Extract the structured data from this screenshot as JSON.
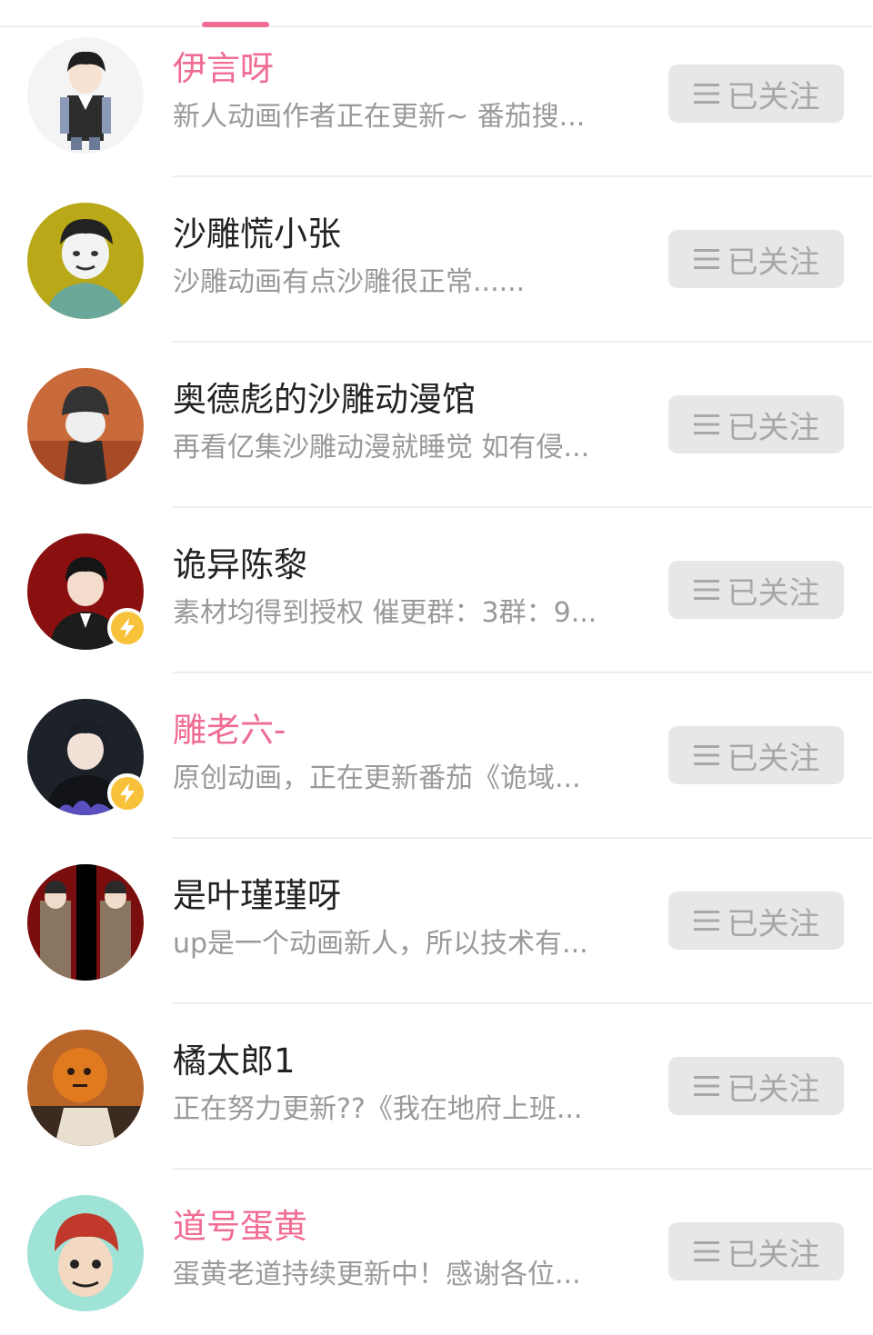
{
  "colors": {
    "accent": "#f06c93",
    "name_default": "#222222",
    "description": "#999999",
    "button_bg": "#e7e7e7",
    "button_text": "#a8a8a8",
    "badge": "#f7c23a"
  },
  "users": [
    {
      "name": "伊言呀",
      "vip": true,
      "badge": false,
      "description": "新人动画作者正在更新~ 番茄搜...",
      "button_label": "已关注",
      "avatar": "character-avatar-boy-vest"
    },
    {
      "name": "沙雕慌小张",
      "vip": false,
      "badge": false,
      "description": "沙雕动画有点沙雕很正常......",
      "button_label": "已关注",
      "avatar": "meme-face-avatar"
    },
    {
      "name": "奥德彪的沙雕动漫馆",
      "vip": false,
      "badge": false,
      "description": "再看亿集沙雕动漫就睡觉 如有侵...",
      "button_label": "已关注",
      "avatar": "helmet-character-avatar"
    },
    {
      "name": "诡异陈黎",
      "vip": false,
      "badge": true,
      "description": "素材均得到授权 催更群：3群：9...",
      "button_label": "已关注",
      "avatar": "suit-boy-red-avatar"
    },
    {
      "name": "雕老六-",
      "vip": true,
      "badge": true,
      "description": "原创动画，正在更新番茄《诡域...",
      "button_label": "已关注",
      "avatar": "hoodie-boy-avatar"
    },
    {
      "name": "是叶瑾瑾呀",
      "vip": false,
      "badge": false,
      "description": "up是一个动画新人，所以技术有...",
      "button_label": "已关注",
      "avatar": "twin-soldiers-avatar"
    },
    {
      "name": "橘太郎1",
      "vip": false,
      "badge": false,
      "description": "正在努力更新??《我在地府上班...",
      "button_label": "已关注",
      "avatar": "pumpkin-skeleton-avatar"
    },
    {
      "name": "道号蛋黄",
      "vip": true,
      "badge": false,
      "description": "蛋黄老道持续更新中！感谢各位...",
      "button_label": "已关注",
      "avatar": "cartoon-red-hair-avatar"
    }
  ]
}
